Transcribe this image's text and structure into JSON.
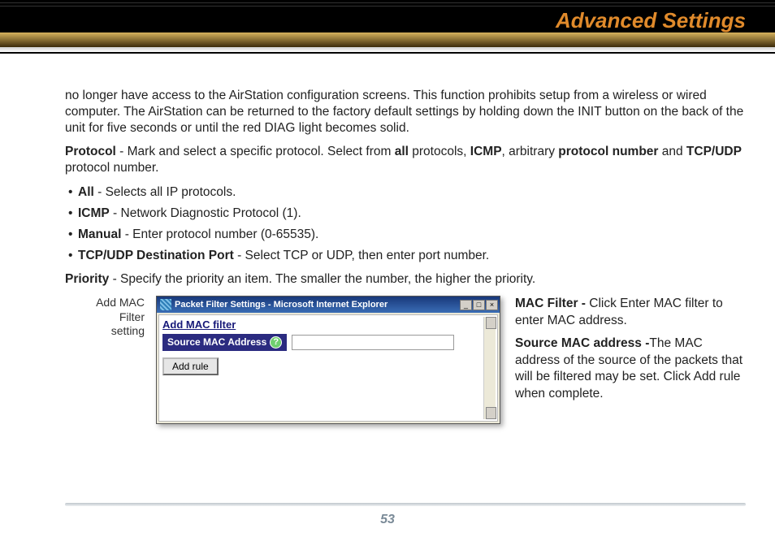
{
  "page_title": "Advanced Settings",
  "page_number": "53",
  "intro_paragraph": "no longer have access to the AirStation configuration screens.  This function prohibits setup from a wireless or wired computer.  The AirStation can be returned to the factory default settings by holding down the INIT button on the back of the unit for five seconds or until the red DIAG light becomes solid.",
  "protocol": {
    "lead_bold": "Protocol",
    "lead_rest_1": "  - Mark and select a specific protocol.  Select from ",
    "b_all": "all",
    "rest_2": " protocols, ",
    "b_icmp": "ICMP",
    "rest_3": ", arbitrary ",
    "b_protnum": "protocol number",
    "rest_4": " and ",
    "b_tcpudp": "TCP/UDP",
    "rest_5": " protocol number."
  },
  "bullets": [
    {
      "bold": "All",
      "rest": " - Selects all IP protocols."
    },
    {
      "bold": "ICMP",
      "rest": " - Network Diagnostic Protocol (1)."
    },
    {
      "bold": "Manual",
      "rest": " - Enter protocol number (0-65535)."
    },
    {
      "bold": "TCP/UDP Destination Port",
      "rest": " - Select TCP or UDP, then enter port number."
    }
  ],
  "priority": {
    "bold": "Priority",
    "rest": " - Specify the priority  an item.  The smaller the number, the higher the priority."
  },
  "caption_lines": [
    "Add MAC",
    "Filter",
    "setting"
  ],
  "window": {
    "title": "Packet Filter Settings - Microsoft Internet Explorer",
    "section": "Add MAC filter",
    "field_label": "Source MAC Address",
    "help_symbol": "?",
    "input_value": "",
    "add_rule_label": "Add rule"
  },
  "right": {
    "p1_bold": "MAC Filter - ",
    "p1_rest": "Click Enter MAC filter to enter MAC address.",
    "p2_bold": "Source MAC address -",
    "p2_rest": "The MAC address of the source of the packets that will be filtered may be set. Click Add rule when complete."
  }
}
